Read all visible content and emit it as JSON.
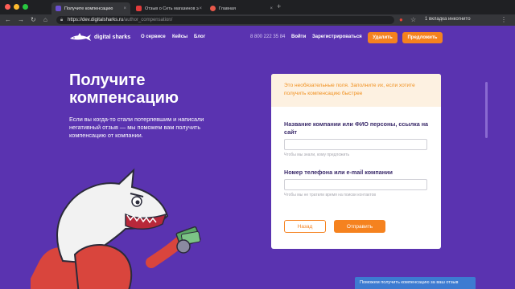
{
  "browser": {
    "tabs": [
      {
        "title": "Получите компенсацию",
        "active": true
      },
      {
        "title": "Отзыв о Сеть магазинов эл...",
        "active": false
      },
      {
        "title": "Главная",
        "active": false
      }
    ],
    "url_domain": "https://dev.digitalsharks.ru",
    "url_path": "/author_compensation/",
    "incognito_label": "1 вкладка инкогнито"
  },
  "header": {
    "logo_text": "digital sharks",
    "menu": [
      "О сервисе",
      "Кейсы",
      "Блог"
    ],
    "phone": "8 800 222 35 84",
    "login": "Войти",
    "register": "Зарегистрироваться",
    "delete_button": "Удалить",
    "offer_button": "Предложить"
  },
  "hero": {
    "title": "Получите компенсацию",
    "description": "Если вы когда-то стали потерпевшим и написали негативный отзыв — мы поможем вам получить компенсацию от компании."
  },
  "form": {
    "note": "Это необязательные поля. Заполните их, если хотите получить компенсацию быстрее",
    "company_label": "Название компании или ФИО персоны, ссылка на сайт",
    "company_value": "",
    "company_hint": "Чтобы мы знали, кому предложить",
    "contact_label": "Номер телефона или e-mail компании",
    "contact_value": "",
    "contact_hint": "Чтобы мы не тратили время на поиски контактов",
    "back_button": "Назад",
    "submit_button": "Отправить"
  },
  "toast": "Поможем получить компенсацию за ваш отзыв",
  "colors": {
    "brand_purple": "#5a33b0",
    "accent_orange": "#f5821f"
  }
}
